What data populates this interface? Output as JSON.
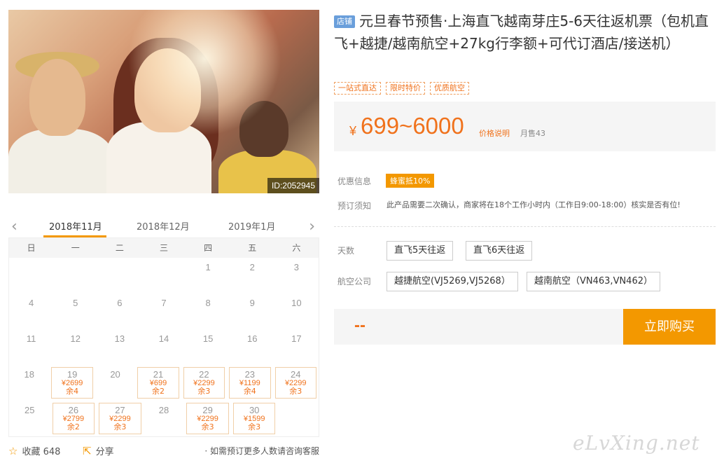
{
  "photo": {
    "id_label": "ID:2052945"
  },
  "calendar": {
    "months": [
      "2018年11月",
      "2018年12月",
      "2019年1月"
    ],
    "weekdays": [
      "日",
      "一",
      "二",
      "三",
      "四",
      "五",
      "六"
    ],
    "rows": [
      [
        {
          "d": ""
        },
        {
          "d": ""
        },
        {
          "d": ""
        },
        {
          "d": ""
        },
        {
          "d": "1"
        },
        {
          "d": "2"
        },
        {
          "d": "3"
        }
      ],
      [
        {
          "d": "4"
        },
        {
          "d": "5"
        },
        {
          "d": "6"
        },
        {
          "d": "7"
        },
        {
          "d": "8"
        },
        {
          "d": "9"
        },
        {
          "d": "10"
        }
      ],
      [
        {
          "d": "11"
        },
        {
          "d": "12"
        },
        {
          "d": "13"
        },
        {
          "d": "14"
        },
        {
          "d": "15"
        },
        {
          "d": "16"
        },
        {
          "d": "17"
        }
      ],
      [
        {
          "d": "18"
        },
        {
          "d": "19",
          "p": "¥2699",
          "s": "余4"
        },
        {
          "d": "20"
        },
        {
          "d": "21",
          "p": "¥699",
          "s": "余2"
        },
        {
          "d": "22",
          "p": "¥2299",
          "s": "余3"
        },
        {
          "d": "23",
          "p": "¥1199",
          "s": "余4"
        },
        {
          "d": "24",
          "p": "¥2299",
          "s": "余3"
        }
      ],
      [
        {
          "d": "25"
        },
        {
          "d": "26",
          "p": "¥2799",
          "s": "余2"
        },
        {
          "d": "27",
          "p": "¥2299",
          "s": "余3"
        },
        {
          "d": "28"
        },
        {
          "d": "29",
          "p": "¥2299",
          "s": "余3"
        },
        {
          "d": "30",
          "p": "¥1599",
          "s": "余3"
        },
        {
          "d": ""
        }
      ]
    ]
  },
  "bottom": {
    "fav_label": "收藏 648",
    "share_label": "分享",
    "note": "· 如需预订更多人数请咨询客服"
  },
  "product": {
    "shop_tag": "店铺",
    "title": "元旦春节预售·上海直飞越南芽庄5-6天往返机票（包机直飞+越捷/越南航空+27kg行李额+可代订酒店/接送机）",
    "tags": [
      "一站式直达",
      "限时特价",
      "优质航空"
    ],
    "currency": "¥",
    "price": "699~6000",
    "price_explain": "价格说明",
    "monthly_sales": "月售43",
    "promo_label": "优惠信息",
    "promo_badge": "蜂蜜抵10%",
    "notice_label": "预订须知",
    "notice_text": "此产品需要二次确认，商家将在18个工作小时内（工作日9:00-18:00）核实是否有位!",
    "days_label": "天数",
    "days_options": [
      "直飞5天往返",
      "直飞6天往返"
    ],
    "airline_label": "航空公司",
    "airline_options": [
      "越捷航空(VJ5269,VJ5268）",
      "越南航空（VN463,VN462）"
    ],
    "total_placeholder": "--",
    "buy_button": "立即购买"
  },
  "watermark": "eLvXing.net",
  "colors": {
    "accent": "#f39800",
    "price": "#f0721c",
    "shop_tag": "#6a9fdb"
  }
}
